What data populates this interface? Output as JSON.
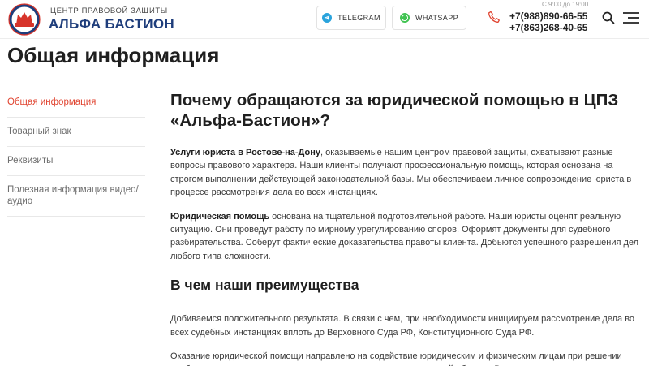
{
  "header": {
    "brand_subtitle": "ЦЕНТР ПРАВОВОЙ ЗАЩИТЫ",
    "brand_name": "АЛЬФА БАСТИОН",
    "telegram_label": "TELEGRAM",
    "whatsapp_label": "WHATSAPP",
    "hours": "С 9:00 до 19:00",
    "phone1": "+7(988)890-66-55",
    "phone2": "+7(863)268-40-65",
    "icons": [
      "logo",
      "telegram-icon",
      "whatsapp-icon",
      "phone-icon",
      "search-icon",
      "menu-icon"
    ],
    "colors": {
      "brand": "#1e3d7b",
      "accent": "#e0432f",
      "telegram": "#2aa3dc",
      "whatsapp": "#40c351"
    }
  },
  "page_title": "Общая информация",
  "sidebar": {
    "items": [
      {
        "label": "Общая информация",
        "active": true
      },
      {
        "label": "Товарный знак",
        "active": false
      },
      {
        "label": "Реквизиты",
        "active": false
      },
      {
        "label": "Полезная информация видео/аудио",
        "active": false
      }
    ]
  },
  "main": {
    "heading": "Почему обращаются за юридической помощью в ЦПЗ «Альфа-Бастион»?",
    "p1_bold": "Услуги юриста в Ростове-на-Дону",
    "p1_text": ", оказываемые нашим центром правовой защиты, охватывают разные вопросы правового характера. Наши клиенты получают профессиональную помощь, которая основана на строгом выполнении действующей законодательной базы. Мы обеспечиваем личное сопровождение юриста в процессе рассмотрения дела во всех инстанциях.",
    "p2_bold": "Юридическая помощь",
    "p2_text": " основана на тщательной подготовительной работе. Наши юристы оценят реальную ситуацию. Они проведут работу по мирному урегулированию споров. Оформят документы для судебного разбирательства. Соберут фактические доказательства правоты клиента. Добьются успешного разрешения дел любого типа сложности.",
    "subheading": "В чем наши преимущества",
    "p3": "Добиваемся положительного результата. В связи с чем, при необходимости инициируем рассмотрение дела во всех судебных инстанциях вплоть до Верховного Суда РФ, Конституционного Суда РФ.",
    "p4": "Оказание юридической помощи направлено на содействие юридическим и физическим лицам при решении проблем, которые относятся к реализации норм права в конкретной области. В нашем центре"
  }
}
